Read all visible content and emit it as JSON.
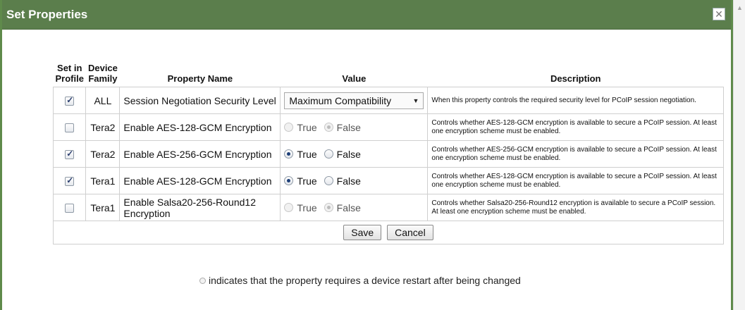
{
  "dialog": {
    "title": "Set Properties",
    "close_glyph": "✕"
  },
  "table": {
    "headers": {
      "set_in_profile": [
        "Set in",
        "Profile"
      ],
      "device_family": [
        "Device",
        "Family"
      ],
      "property_name": "Property Name",
      "value": "Value",
      "description": "Description"
    },
    "rows": [
      {
        "checked": true,
        "family": "ALL",
        "name": "Session Negotiation Security Level",
        "value_type": "select",
        "select_value": "Maximum Compatibility",
        "description": "When this property controls the required security level for PCoIP session negotiation."
      },
      {
        "checked": false,
        "family": "Tera2",
        "name": "Enable AES-128-GCM Encryption",
        "value_type": "radio",
        "true_label": "True",
        "false_label": "False",
        "selected": "false",
        "disabled": true,
        "description": "Controls whether AES-128-GCM encryption is available to secure a PCoIP session. At least one encryption scheme must be enabled."
      },
      {
        "checked": true,
        "family": "Tera2",
        "name": "Enable AES-256-GCM Encryption",
        "value_type": "radio",
        "true_label": "True",
        "false_label": "False",
        "selected": "true",
        "disabled": false,
        "description": "Controls whether AES-256-GCM encryption is available to secure a PCoIP session. At least one encryption scheme must be enabled."
      },
      {
        "checked": true,
        "family": "Tera1",
        "name": "Enable AES-128-GCM Encryption",
        "value_type": "radio",
        "true_label": "True",
        "false_label": "False",
        "selected": "true",
        "disabled": false,
        "description": "Controls whether AES-128-GCM encryption is available to secure a PCoIP session. At least one encryption scheme must be enabled."
      },
      {
        "checked": false,
        "family": "Tera1",
        "name": "Enable Salsa20-256-Round12 Encryption",
        "value_type": "radio",
        "true_label": "True",
        "false_label": "False",
        "selected": "false",
        "disabled": true,
        "description": "Controls whether Salsa20-256-Round12 encryption is available to secure a PCoIP session. At least one encryption scheme must be enabled."
      }
    ]
  },
  "actions": {
    "save_label": "Save",
    "cancel_label": "Cancel"
  },
  "footnote": "indicates that the property requires a device restart after being changed",
  "colors": {
    "titlebar": "#5b7e4c",
    "border": "#5f8a4b"
  }
}
